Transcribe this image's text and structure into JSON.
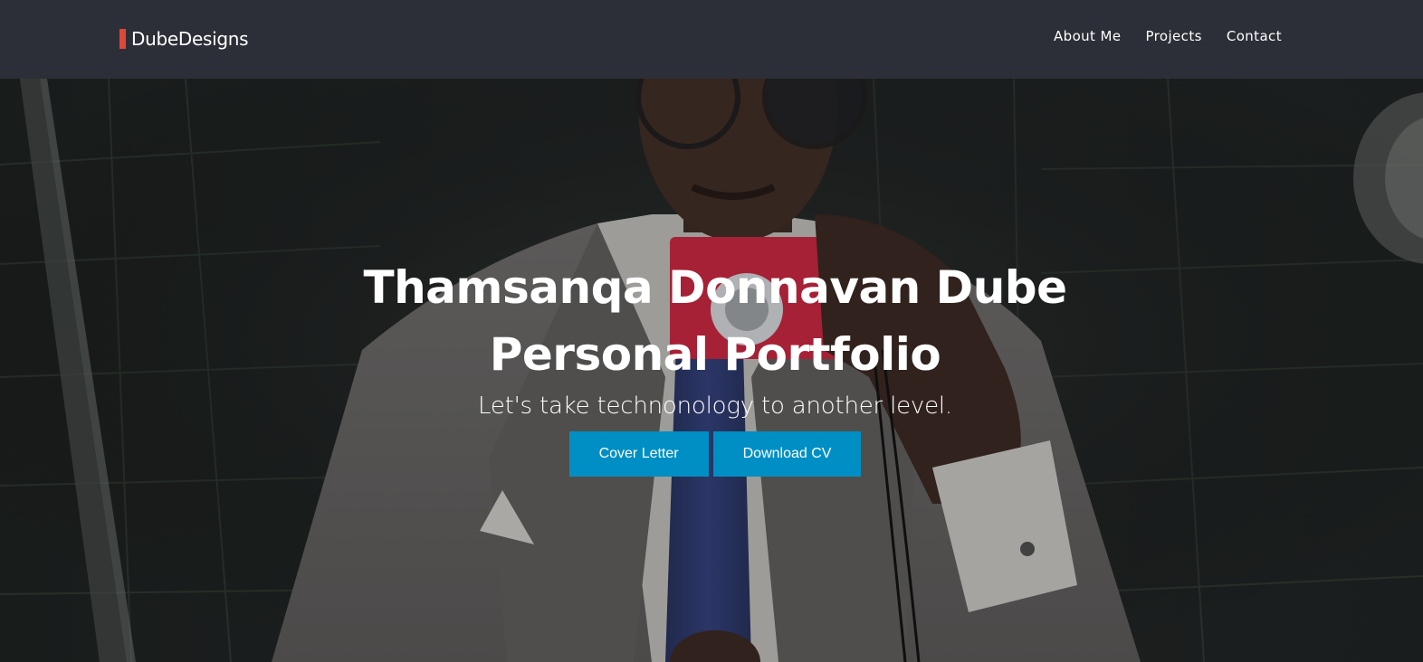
{
  "brand": {
    "name": "DubeDesigns",
    "accent_color": "#e0473a"
  },
  "nav": {
    "items": [
      {
        "label": "About Me"
      },
      {
        "label": "Projects"
      },
      {
        "label": "Contact"
      }
    ]
  },
  "hero": {
    "title_line1": "Thamsanqa Donnavan Dube",
    "title_line2": "Personal Portfolio",
    "subtitle": "Let's take technonology to another level.",
    "buttons": [
      {
        "label": "Cover Letter"
      },
      {
        "label": "Download CV"
      }
    ],
    "button_color": "#008fc4",
    "background_image": "selfie-in-mirror-photo"
  },
  "colors": {
    "navbar_bg": "#2c2f37",
    "text": "#ffffff"
  }
}
